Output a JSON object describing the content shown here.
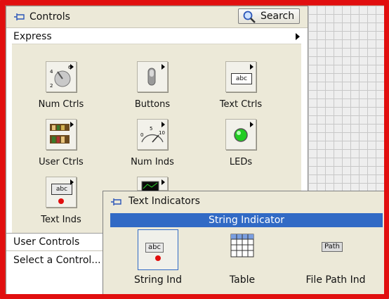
{
  "palette": {
    "title": "Controls",
    "search_label": "Search",
    "category": "Express",
    "tiles": [
      {
        "label": "Num Ctrls"
      },
      {
        "label": "Buttons"
      },
      {
        "label": "Text Ctrls"
      },
      {
        "label": "User Ctrls"
      },
      {
        "label": "Num Inds"
      },
      {
        "label": "LEDs"
      },
      {
        "label": "Text Inds"
      }
    ],
    "lower": {
      "user_controls": "User Controls",
      "status": "Select a Control..."
    }
  },
  "popup": {
    "title": "Text Indicators",
    "highlight": "String Indicator",
    "items": [
      {
        "label": "String Ind",
        "icon_text": "abc"
      },
      {
        "label": "Table"
      },
      {
        "label": "File Path Ind",
        "icon_text": "Path"
      }
    ]
  },
  "icons": {
    "text_ctrl_text": "abc",
    "text_ind_text": "abc",
    "num_ind_scale": [
      "0",
      "5",
      "10"
    ]
  },
  "colors": {
    "frame": "#e10f0f",
    "highlight": "#316ac5",
    "led": "#22cc22"
  }
}
